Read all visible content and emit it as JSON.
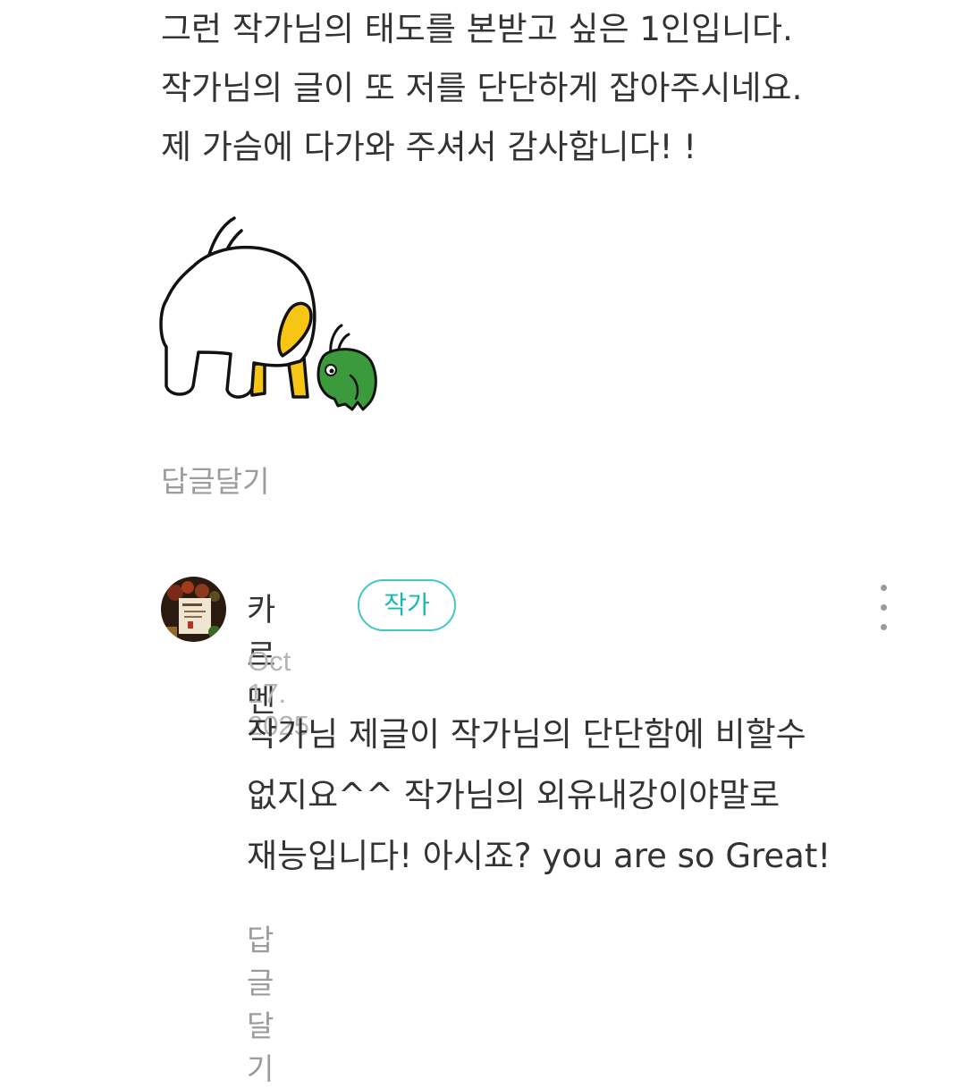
{
  "comment": {
    "lines": [
      "그런 작가님의 태도를 본받고 싶은 1인입니다.",
      "작가님의 글이 또 저를 단단하게 잡아주시네요.",
      "제 가슴에 다가와 주셔서 감사합니다! !"
    ],
    "reply_label": "답글달기"
  },
  "reply": {
    "author_name": "카르멘",
    "author_badge": "작가",
    "date": "Oct 17. 2025",
    "lines": [
      "작가님 제글이 작가님의 단단함에 비할수",
      "없지요^^ 작가님의 외유내강이야말로",
      "재능입니다! 아시죠? you are so Great!"
    ],
    "reply_label": "답글달기"
  },
  "colors": {
    "text": "#333333",
    "muted": "#9c9c9c",
    "date": "#b5b5b5",
    "badge_accent": "#3fc9c3",
    "sticker_yellow": "#f7c514",
    "sticker_green": "#3a9a3c"
  },
  "icons": {
    "more": "more-vertical-icon",
    "sticker": "sticker-character"
  }
}
